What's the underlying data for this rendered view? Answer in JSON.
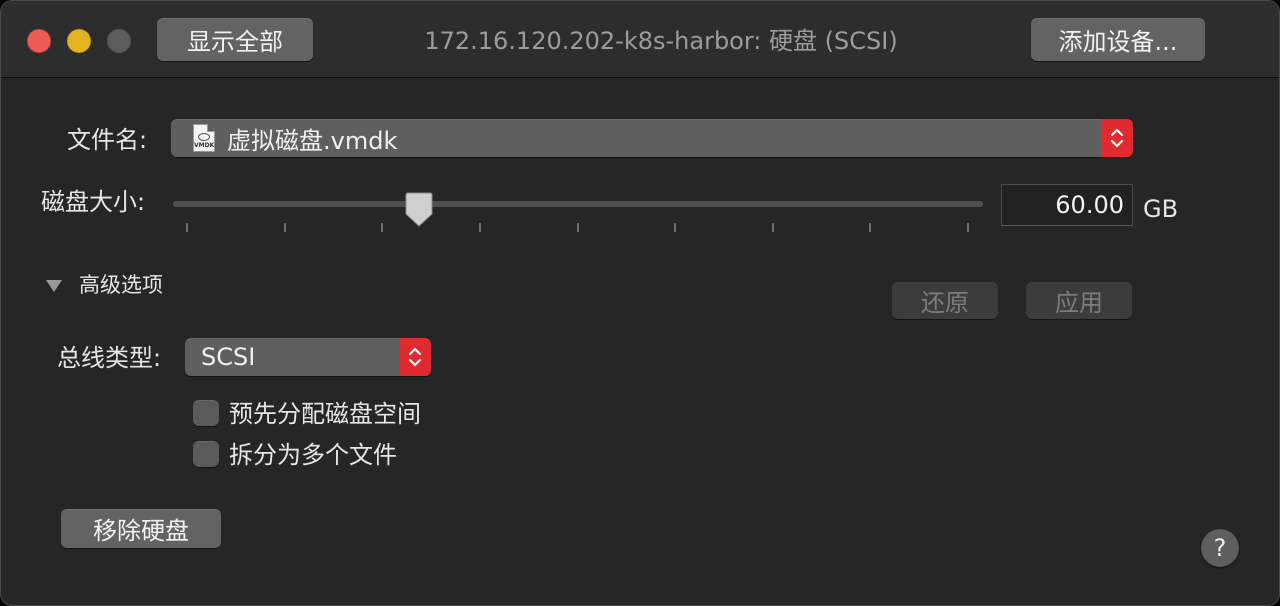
{
  "titlebar": {
    "title": "172.16.120.202-k8s-harbor: 硬盘 (SCSI)",
    "show_all_label": "显示全部",
    "add_device_label": "添加设备..."
  },
  "file": {
    "label": "文件名:",
    "value": "虚拟磁盘.vmdk",
    "icon": "vmdk-file-icon",
    "icon_badge": "VMDK"
  },
  "disk_size": {
    "label": "磁盘大小:",
    "slider_fraction": 0.305,
    "value": "60.00",
    "unit": "GB"
  },
  "advanced": {
    "toggle_label": "高级选项",
    "revert_label": "还原",
    "apply_label": "应用"
  },
  "bus": {
    "label": "总线类型:",
    "value": "SCSI"
  },
  "options": {
    "preallocate_label": "预先分配磁盘空间",
    "split_label": "拆分为多个文件"
  },
  "remove_disk_label": "移除硬盘",
  "help_label": "?",
  "colors": {
    "window_bg": "#262626",
    "stepper_red": "#e02a2f",
    "close": "#ec5b55",
    "minimize": "#e1b520"
  }
}
